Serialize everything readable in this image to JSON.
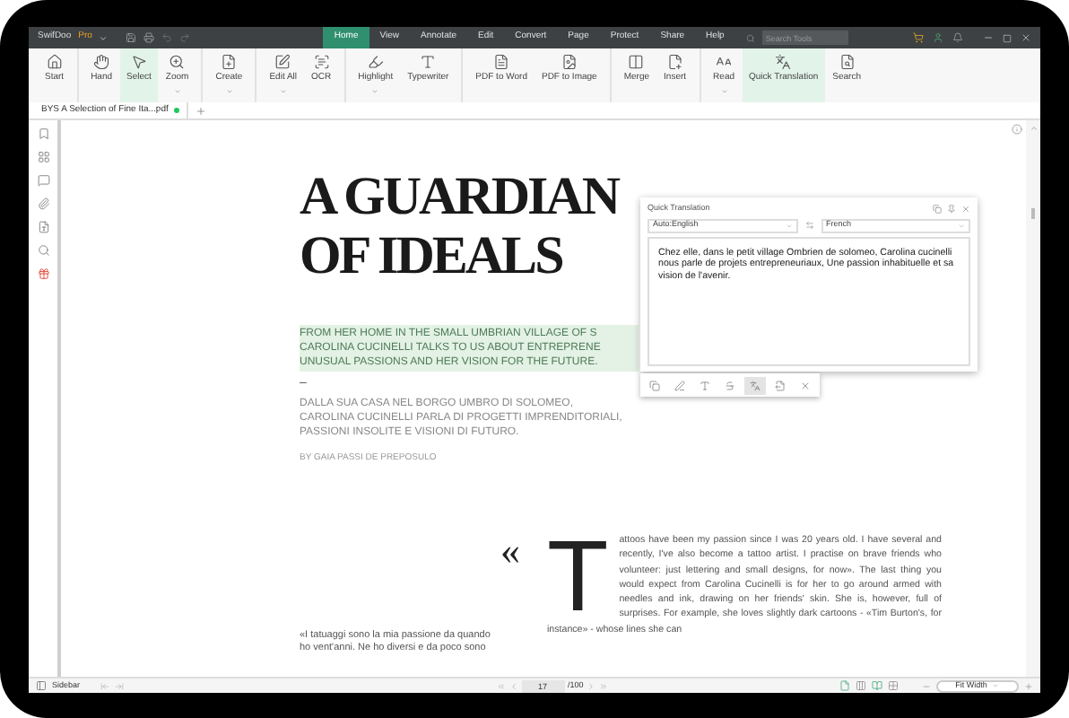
{
  "app": {
    "name": "SwifDoo",
    "edition": "Pro"
  },
  "menu": [
    {
      "label": "Home",
      "selected": true
    },
    {
      "label": "View",
      "selected": false
    },
    {
      "label": "Annotate",
      "selected": false
    },
    {
      "label": "Edit",
      "selected": false
    },
    {
      "label": "Convert",
      "selected": false
    },
    {
      "label": "Page",
      "selected": false
    },
    {
      "label": "Protect",
      "selected": false
    },
    {
      "label": "Share",
      "selected": false
    },
    {
      "label": "Help",
      "selected": false
    }
  ],
  "search": {
    "placeholder": "Search Tools"
  },
  "toolbar_groups": [
    [
      {
        "label": "Start",
        "selected": false,
        "dropdown": false
      }
    ],
    [
      {
        "label": "Hand",
        "selected": false,
        "dropdown": false
      },
      {
        "label": "Select",
        "selected": true,
        "dropdown": false
      },
      {
        "label": "Zoom",
        "selected": false,
        "dropdown": true
      }
    ],
    [
      {
        "label": "Create",
        "selected": false,
        "dropdown": true
      }
    ],
    [
      {
        "label": "Edit All",
        "selected": false,
        "dropdown": true
      },
      {
        "label": "OCR",
        "selected": false,
        "dropdown": false
      }
    ],
    [
      {
        "label": "Highlight",
        "selected": false,
        "dropdown": true
      },
      {
        "label": "Typewriter",
        "selected": false,
        "dropdown": false
      }
    ],
    [
      {
        "label": "PDF to Word",
        "selected": false,
        "dropdown": false
      },
      {
        "label": "PDF to Image",
        "selected": false,
        "dropdown": false
      }
    ],
    [
      {
        "label": "Merge",
        "selected": false,
        "dropdown": false
      },
      {
        "label": "Insert",
        "selected": false,
        "dropdown": false
      }
    ],
    [
      {
        "label": "Read",
        "selected": false,
        "dropdown": true
      },
      {
        "label": "Quick Translation",
        "selected": true,
        "dropdown": false
      },
      {
        "label": "Search",
        "selected": false,
        "dropdown": false
      }
    ]
  ],
  "document_tab": {
    "title": "BYS A Selection of Fine Ita...pdf",
    "modified": true
  },
  "page": {
    "headline": [
      "A GUARDIAN",
      "OF IDEALS"
    ],
    "lead": [
      "FROM HER HOME IN THE SMALL UMBRIAN VILLAGE OF S",
      "CAROLINA CUCINELLI TALKS TO US ABOUT ENTREPRENE",
      "UNUSUAL PASSIONS AND HER VISION FOR THE FUTURE."
    ],
    "lead_highlighted": true,
    "dash": "–",
    "italian_lead": [
      "DALLA SUA CASA NEL BORGO UMBRO DI SOLOMEO,",
      "CAROLINA CUCINELLI PARLA DI PROGETTI IMPRENDITORIALI,",
      "PASSIONI INSOLITE E VISIONI DI FUTURO."
    ],
    "byline": "BY GAIA PASSI DE PREPOSULO",
    "quote_mark": "«",
    "pull_quote": [
      "«I tatuaggi sono la mia passione da quando",
      "ho vent'anni. Ne ho diversi e da poco sono"
    ],
    "drop_cap": "T",
    "body": "attoos have been my passion since I was 20 years old. I have several and recently, I've also become a tattoo artist. I practise on brave friends who volunteer: just lettering and small designs, for now». The last thing you would expect from Carolina Cucinelli is for her to go around armed with needles and ink, drawing on her friends' skin. She is, however, full of surprises. For example, she loves slightly dark cartoons - «Tim Burton's, for instance» - whose lines she can"
  },
  "translation_popup": {
    "title": "Quick Translation",
    "source_language": "Auto:English",
    "target_language": "French",
    "result": "Chez elle, dans le petit village Ombrien de solomeo, Carolina cucinelli nous parle de projets entrepreneuriaux, Une passion inhabituelle et sa vision de l'avenir."
  },
  "text_tools": [
    {
      "selected": false
    },
    {
      "selected": false
    },
    {
      "selected": false
    },
    {
      "selected": false
    },
    {
      "selected": true
    },
    {
      "selected": false
    },
    {
      "selected": false
    }
  ],
  "status_bar": {
    "sidebar_label": "Sidebar",
    "current_page": "17",
    "total_pages": "/100",
    "view_modes": [
      {
        "selected": true
      },
      {
        "selected": false
      },
      {
        "selected": true
      },
      {
        "selected": false
      }
    ],
    "zoom": "Fit Width"
  }
}
